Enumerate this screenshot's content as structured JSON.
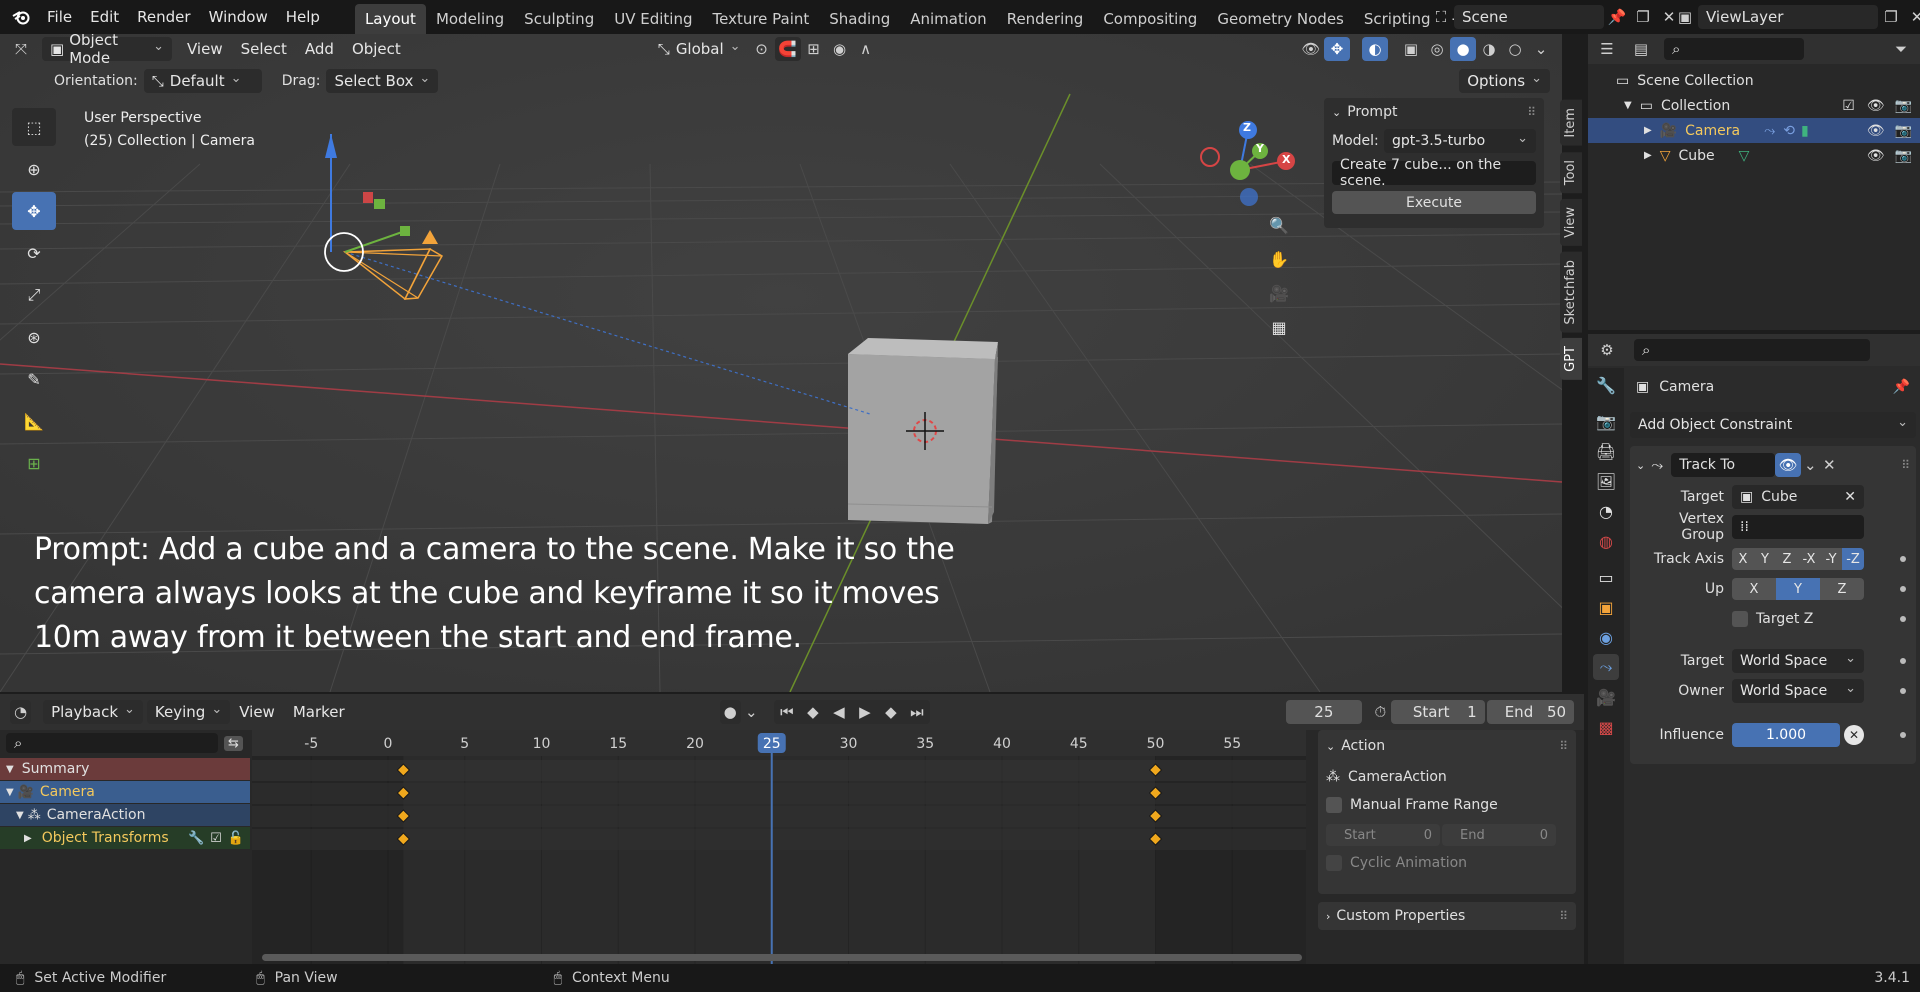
{
  "topbar": {
    "menus": [
      "File",
      "Edit",
      "Render",
      "Window",
      "Help"
    ],
    "tabs": [
      "Layout",
      "Modeling",
      "Sculpting",
      "UV Editing",
      "Texture Paint",
      "Shading",
      "Animation",
      "Rendering",
      "Compositing",
      "Geometry Nodes",
      "Scripting"
    ],
    "active_tab": "Layout",
    "add_tab": "+",
    "scene": "Scene",
    "view_layer": "ViewLayer"
  },
  "viewport": {
    "mode": "Object Mode",
    "menus": [
      "View",
      "Select",
      "Add",
      "Object"
    ],
    "transform_orientation": "Global",
    "orientation_label": "Orientation:",
    "orientation_value": "Default",
    "drag_label": "Drag:",
    "drag_value": "Select Box",
    "options": "Options",
    "info_line1": "User Perspective",
    "info_line2": "(25) Collection | Camera",
    "overlay_text_line1": "Prompt: Add a cube and a camera to the scene. Make it so the",
    "overlay_text_line2": "camera always looks at the cube and keyframe it so it moves",
    "overlay_text_line3": "10m away from it between the start and end frame.",
    "gizmo": {
      "z": "Z",
      "y": "Y",
      "x": "X"
    }
  },
  "gpt_panel": {
    "title": "Prompt",
    "model_label": "Model:",
    "model_value": "gpt-3.5-turbo",
    "prompt_value": "Create 7 cube... on the scene.",
    "execute": "Execute"
  },
  "side_tabs": [
    "Item",
    "Tool",
    "View",
    "Sketchfab",
    "GPT"
  ],
  "outliner": {
    "scene_collection": "Scene Collection",
    "collection": "Collection",
    "items": [
      {
        "name": "Camera",
        "selected": true
      },
      {
        "name": "Cube",
        "selected": false
      }
    ]
  },
  "properties": {
    "object_name": "Camera",
    "add_constraint": "Add Object Constraint",
    "constraint_name": "Track To",
    "target_label": "Target",
    "target_value": "Cube",
    "vertex_group_label": "Vertex Group",
    "track_axis_label": "Track Axis",
    "track_axes": [
      "X",
      "Y",
      "Z",
      "-X",
      "-Y",
      "-Z"
    ],
    "active_track_axis": "-Z",
    "up_label": "Up",
    "up_axes": [
      "X",
      "Y",
      "Z"
    ],
    "active_up": "Y",
    "target_z_label": "Target Z",
    "space_target_label": "Target",
    "space_target_value": "World Space",
    "space_owner_label": "Owner",
    "space_owner_value": "World Space",
    "influence_label": "Influence",
    "influence_value": "1.000"
  },
  "timeline": {
    "menus": [
      "Playback",
      "Keying",
      "View",
      "Marker"
    ],
    "current_frame": "25",
    "start_label": "Start",
    "start_value": "1",
    "end_label": "End",
    "end_value": "50",
    "ruler": [
      "-5",
      "0",
      "5",
      "10",
      "15",
      "20",
      "25",
      "30",
      "35",
      "40",
      "45",
      "50",
      "55"
    ],
    "channels": [
      "Summary",
      "Camera",
      "CameraAction",
      "Object Transforms"
    ],
    "keyframes": [
      1,
      50
    ]
  },
  "action_panel": {
    "title": "Action",
    "action_name": "CameraAction",
    "manual_frame_range": "Manual Frame Range",
    "start_label": "Start",
    "start_value": "0",
    "end_label": "End",
    "end_value": "0",
    "cyclic": "Cyclic Animation",
    "custom_props": "Custom Properties"
  },
  "statusbar": {
    "left": "Set Active Modifier",
    "mid": "Pan View",
    "right": "Context Menu",
    "version": "3.4.1"
  },
  "colors": {
    "accent": "#4772b3",
    "selected_text": "#f4c95d",
    "keyframe": "#f0a81d",
    "playhead": "#4772b3"
  }
}
